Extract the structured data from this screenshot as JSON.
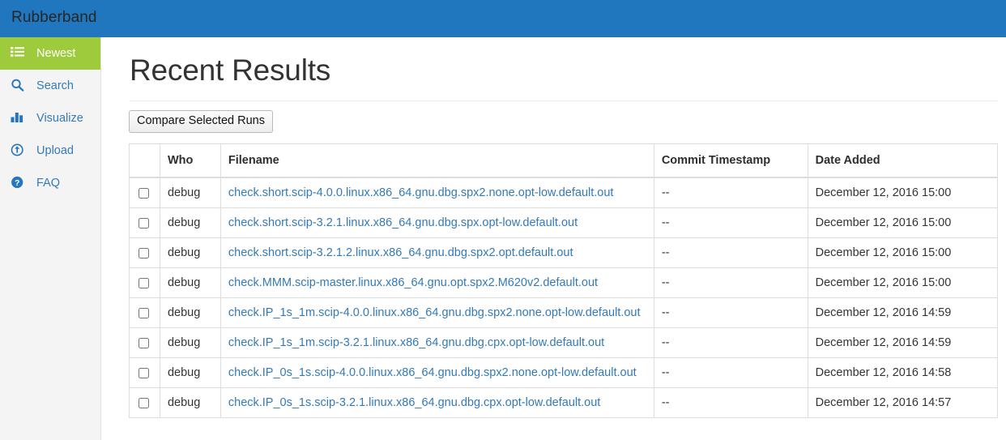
{
  "navbar": {
    "brand": "Rubberband"
  },
  "sidebar": {
    "items": [
      {
        "label": "Newest",
        "icon": "list-icon",
        "active": true
      },
      {
        "label": "Search",
        "icon": "search-icon",
        "active": false
      },
      {
        "label": "Visualize",
        "icon": "bar-chart-icon",
        "active": false
      },
      {
        "label": "Upload",
        "icon": "upload-circle-icon",
        "active": false
      },
      {
        "label": "FAQ",
        "icon": "question-circle-icon",
        "active": false
      }
    ]
  },
  "main": {
    "title": "Recent Results",
    "compare_button": "Compare Selected Runs",
    "table": {
      "columns": [
        "",
        "Who",
        "Filename",
        "Commit Timestamp",
        "Date Added"
      ],
      "rows": [
        {
          "checked": false,
          "who": "debug",
          "filename": "check.short.scip-4.0.0.linux.x86_64.gnu.dbg.spx2.none.opt-low.default.out",
          "commit_timestamp": "--",
          "date_added": "December 12, 2016 15:00"
        },
        {
          "checked": false,
          "who": "debug",
          "filename": "check.short.scip-3.2.1.linux.x86_64.gnu.dbg.spx.opt-low.default.out",
          "commit_timestamp": "--",
          "date_added": "December 12, 2016 15:00"
        },
        {
          "checked": false,
          "who": "debug",
          "filename": "check.short.scip-3.2.1.2.linux.x86_64.gnu.dbg.spx2.opt.default.out",
          "commit_timestamp": "--",
          "date_added": "December 12, 2016 15:00"
        },
        {
          "checked": false,
          "who": "debug",
          "filename": "check.MMM.scip-master.linux.x86_64.gnu.opt.spx2.M620v2.default.out",
          "commit_timestamp": "--",
          "date_added": "December 12, 2016 15:00"
        },
        {
          "checked": false,
          "who": "debug",
          "filename": "check.IP_1s_1m.scip-4.0.0.linux.x86_64.gnu.dbg.spx2.none.opt-low.default.out",
          "commit_timestamp": "--",
          "date_added": "December 12, 2016 14:59"
        },
        {
          "checked": false,
          "who": "debug",
          "filename": "check.IP_1s_1m.scip-3.2.1.linux.x86_64.gnu.dbg.cpx.opt-low.default.out",
          "commit_timestamp": "--",
          "date_added": "December 12, 2016 14:59"
        },
        {
          "checked": false,
          "who": "debug",
          "filename": "check.IP_0s_1s.scip-4.0.0.linux.x86_64.gnu.dbg.spx2.none.opt-low.default.out",
          "commit_timestamp": "--",
          "date_added": "December 12, 2016 14:58"
        },
        {
          "checked": false,
          "who": "debug",
          "filename": "check.IP_0s_1s.scip-3.2.1.linux.x86_64.gnu.dbg.cpx.opt-low.default.out",
          "commit_timestamp": "--",
          "date_added": "December 12, 2016 14:57"
        }
      ]
    }
  },
  "colors": {
    "navbar_blue": "#2077bd",
    "active_green": "#9ecb3b",
    "link_blue": "#337ab7",
    "sidebar_bg": "#f4f4f4"
  }
}
